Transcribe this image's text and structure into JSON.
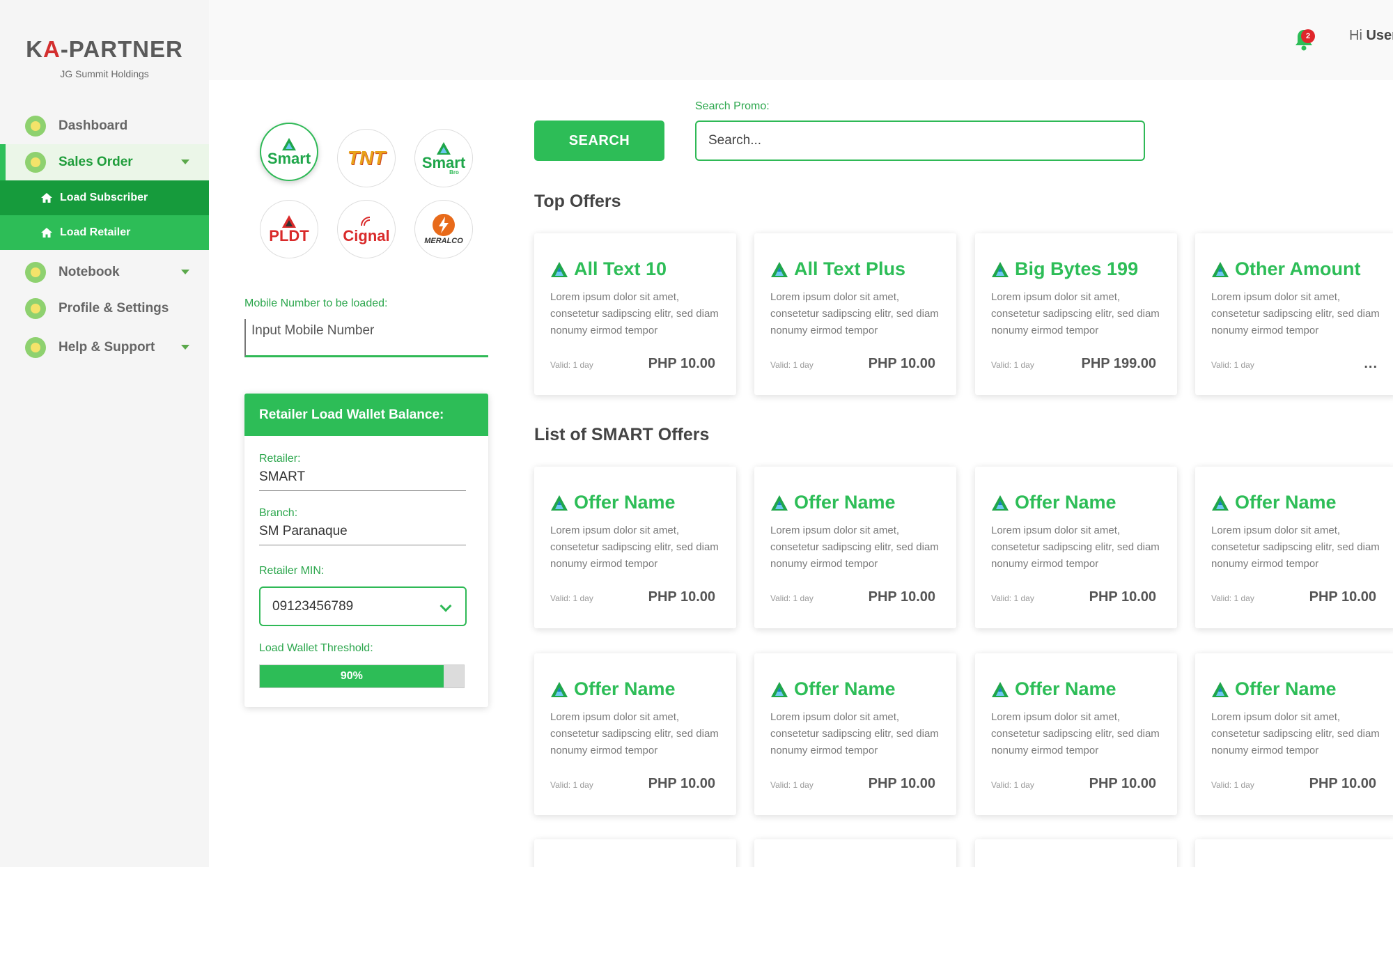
{
  "brand": {
    "name_left": "K",
    "name_a": "A",
    "name_right": "-PARTNER",
    "subtitle": "JG Summit Holdings"
  },
  "header": {
    "greeting_prefix": "Hi ",
    "greeting_user": "User",
    "notification_count": "2"
  },
  "sidebar": {
    "items": [
      {
        "label": "Dashboard"
      },
      {
        "label": "Sales Order"
      },
      {
        "label": "Notebook"
      },
      {
        "label": "Profile & Settings"
      },
      {
        "label": "Help & Support"
      }
    ],
    "sub_items": [
      {
        "label": "Load Subscriber"
      },
      {
        "label": "Load Retailer"
      }
    ]
  },
  "carriers": [
    {
      "name": "Smart",
      "color": "#1fa64a"
    },
    {
      "name": "TNT",
      "color": "#e8a21a"
    },
    {
      "name": "Smart",
      "sub": "Bro",
      "color": "#1fa64a"
    },
    {
      "name": "PLDT",
      "color": "#d92a2a"
    },
    {
      "name": "Cignal",
      "color": "#d92a2a"
    },
    {
      "name": "MERALCO",
      "color": "#e86a1a"
    }
  ],
  "mobile": {
    "label": "Mobile Number to be loaded:",
    "placeholder": "Input Mobile Number"
  },
  "wallet": {
    "title": "Retailer Load Wallet Balance:",
    "retailer_label": "Retailer:",
    "retailer_value": "SMART",
    "branch_label": "Branch:",
    "branch_value": "SM Paranaque",
    "min_label": "Retailer MIN:",
    "min_value": "09123456789",
    "threshold_label": "Load Wallet Threshold:",
    "threshold_value": "90%",
    "threshold_fraction": 0.9
  },
  "search": {
    "button_label": "SEARCH",
    "label": "Search Promo:",
    "placeholder": "Search..."
  },
  "sections": {
    "top_offers": "Top Offers",
    "list_title": "List of SMART Offers"
  },
  "top_offers": [
    {
      "title": "All Text 10",
      "desc": "Lorem ipsum dolor sit amet, consetetur sadipscing elitr, sed diam nonumy eirmod tempor",
      "valid": "Valid: 1 day",
      "price": "PHP 10.00"
    },
    {
      "title": "All Text Plus",
      "desc": "Lorem ipsum dolor sit amet, consetetur sadipscing elitr, sed diam nonumy eirmod tempor",
      "valid": "Valid: 1 day",
      "price": "PHP 10.00"
    },
    {
      "title": "Big Bytes 199",
      "desc": "Lorem ipsum dolor sit amet, consetetur sadipscing elitr, sed diam nonumy eirmod tempor",
      "valid": "Valid: 1 day",
      "price": "PHP 199.00"
    },
    {
      "title": "Other Amount",
      "desc": "Lorem ipsum dolor sit amet, consetetur sadipscing elitr, sed diam nonumy eirmod tempor",
      "valid": "Valid: 1 day",
      "more": "..."
    }
  ],
  "smart_offers": [
    {
      "title": "Offer Name",
      "desc": "Lorem ipsum dolor sit amet, consetetur sadipscing elitr, sed diam nonumy eirmod tempor",
      "valid": "Valid: 1 day",
      "price": "PHP 10.00"
    },
    {
      "title": "Offer Name",
      "desc": "Lorem ipsum dolor sit amet, consetetur sadipscing elitr, sed diam nonumy eirmod tempor",
      "valid": "Valid: 1 day",
      "price": "PHP 10.00"
    },
    {
      "title": "Offer Name",
      "desc": "Lorem ipsum dolor sit amet, consetetur sadipscing elitr, sed diam nonumy eirmod tempor",
      "valid": "Valid: 1 day",
      "price": "PHP 10.00"
    },
    {
      "title": "Offer Name",
      "desc": "Lorem ipsum dolor sit amet, consetetur sadipscing elitr, sed diam nonumy eirmod tempor",
      "valid": "Valid: 1 day",
      "price": "PHP 10.00"
    },
    {
      "title": "Offer Name",
      "desc": "Lorem ipsum dolor sit amet, consetetur sadipscing elitr, sed diam nonumy eirmod tempor",
      "valid": "Valid: 1 day",
      "price": "PHP 10.00"
    },
    {
      "title": "Offer Name",
      "desc": "Lorem ipsum dolor sit amet, consetetur sadipscing elitr, sed diam nonumy eirmod tempor",
      "valid": "Valid: 1 day",
      "price": "PHP 10.00"
    },
    {
      "title": "Offer Name",
      "desc": "Lorem ipsum dolor sit amet, consetetur sadipscing elitr, sed diam nonumy eirmod tempor",
      "valid": "Valid: 1 day",
      "price": "PHP 10.00"
    },
    {
      "title": "Offer Name",
      "desc": "Lorem ipsum dolor sit amet, consetetur sadipscing elitr, sed diam nonumy eirmod tempor",
      "valid": "Valid: 1 day",
      "price": "PHP 10.00"
    }
  ],
  "colors": {
    "accent": "#2dbd57",
    "accent_dark": "#169b3c",
    "badge": "#e0262b"
  },
  "icons": {
    "nav": "circle-illustration-icon",
    "sub": "home-icon",
    "offer": "smart-triangle-icon",
    "bell": "bell-icon"
  }
}
